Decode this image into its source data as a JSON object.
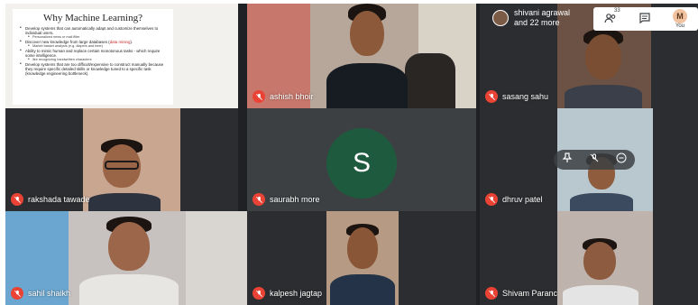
{
  "slide": {
    "title": "Why Machine Learning?",
    "bullets": [
      {
        "text": "Develop systems that can automatically adapt and customize themselves to individual users.",
        "level": 1
      },
      {
        "text": "Personalized news or mail filter",
        "level": 2
      },
      {
        "text": "Discover new knowledge from large databases (",
        "emph": "data mining",
        "tail": ").",
        "level": 1
      },
      {
        "text": "Market basket analysis (e.g. diapers and beer)",
        "level": 2
      },
      {
        "text": "Ability to mimic human and replace certain monotonous tasks - which require some intelligence.",
        "level": 1
      },
      {
        "text": "like recognizing handwritten characters",
        "level": 2
      },
      {
        "text": "Develop systems that are too difficult/expensive to construct manually because they require specific detailed skills or knowledge tuned to a specific task (knowledge engineering bottleneck).",
        "level": 1
      }
    ]
  },
  "viewers": {
    "line1": "shivani agrawal",
    "line2": "and 22 more"
  },
  "controls": {
    "people_count": "33",
    "user_label": "You",
    "user_initial": "M"
  },
  "participants": [
    {
      "name": "ashish bhoir"
    },
    {
      "name": "sasang sahu"
    },
    {
      "name": "rakshada tawade"
    },
    {
      "name": "saurabh more",
      "initial": "S"
    },
    {
      "name": "dhruv patel"
    },
    {
      "name": "sahil shaikh"
    },
    {
      "name": "kalpesh jagtap"
    },
    {
      "name": "Shivam Paranc"
    }
  ],
  "colors": {
    "stage_bg": "#202124",
    "mute_red": "#ea4335",
    "avatar_green": "#1e5b3e"
  }
}
